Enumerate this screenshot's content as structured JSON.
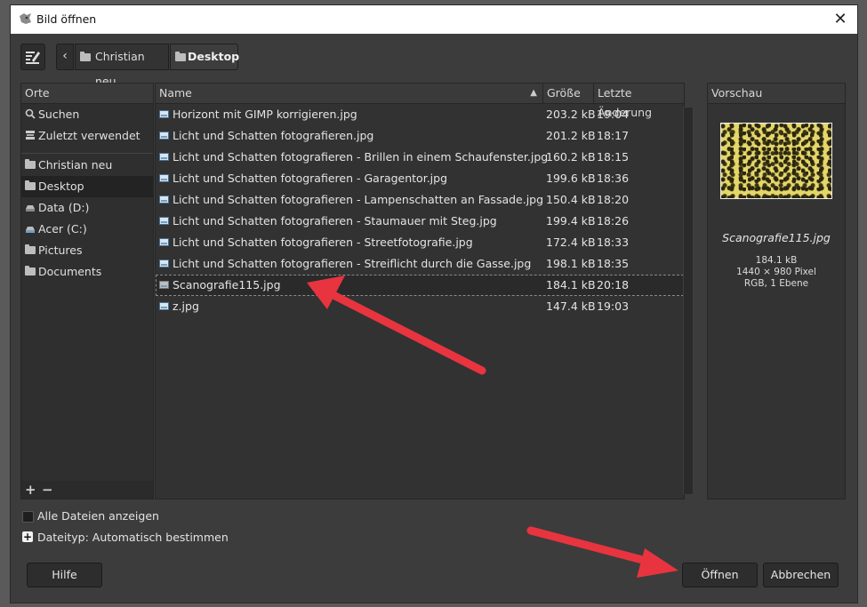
{
  "window": {
    "title": "Bild öffnen",
    "close_glyph": "✕"
  },
  "breadcrumb": {
    "back_glyph": "‹",
    "items": [
      {
        "label": "Christian neu"
      },
      {
        "label": "Desktop"
      }
    ]
  },
  "places": {
    "header": "Orte",
    "items": [
      {
        "label": "Suchen",
        "icon": "search-icon"
      },
      {
        "label": "Zuletzt verwendet",
        "icon": "recent-icon"
      },
      {
        "label": "Christian neu",
        "icon": "folder-icon"
      },
      {
        "label": "Desktop",
        "icon": "folder-icon",
        "selected": true
      },
      {
        "label": "Data (D:)",
        "icon": "drive-icon"
      },
      {
        "label": "Acer (C:)",
        "icon": "drive-icon"
      },
      {
        "label": "Pictures",
        "icon": "folder-icon"
      },
      {
        "label": "Documents",
        "icon": "folder-icon"
      }
    ],
    "add_glyph": "+",
    "remove_glyph": "−"
  },
  "files": {
    "columns": {
      "name": "Name",
      "size": "Größe",
      "modified": "Letzte Änderung"
    },
    "sort_glyph": "▲",
    "rows": [
      {
        "name": "Horizont mit GIMP korrigieren.jpg",
        "size": "203.2 kB",
        "date": "19:04"
      },
      {
        "name": "Licht und Schatten fotografieren.jpg",
        "size": "201.2 kB",
        "date": "18:17"
      },
      {
        "name": "Licht und Schatten fotografieren - Brillen in einem Schaufenster.jpg",
        "size": "160.2 kB",
        "date": "18:15"
      },
      {
        "name": "Licht und Schatten fotografieren - Garagentor.jpg",
        "size": "199.6 kB",
        "date": "18:36"
      },
      {
        "name": "Licht und Schatten fotografieren - Lampenschatten an Fassade.jpg",
        "size": "150.4 kB",
        "date": "18:20"
      },
      {
        "name": "Licht und Schatten fotografieren - Staumauer mit Steg.jpg",
        "size": "199.4 kB",
        "date": "18:26"
      },
      {
        "name": "Licht und Schatten fotografieren - Streetfotografie.jpg",
        "size": "172.4 kB",
        "date": "18:33"
      },
      {
        "name": "Licht und Schatten fotografieren - Streiflicht durch die Gasse.jpg",
        "size": "198.1 kB",
        "date": "18:35"
      },
      {
        "name": "Scanografie115.jpg",
        "size": "184.1 kB",
        "date": "20:18",
        "selected": true
      },
      {
        "name": "z.jpg",
        "size": "147.4 kB",
        "date": "19:03"
      }
    ]
  },
  "preview": {
    "header": "Vorschau",
    "filename": "Scanografie115.jpg",
    "filesize": "184.1 kB",
    "dimensions": "1440 × 980 Pixel",
    "mode": "RGB, 1 Ebene"
  },
  "options": {
    "show_all_label": "Alle Dateien anzeigen",
    "show_all_checked": false,
    "filetype_label": "Dateityp: Automatisch bestimmen",
    "expander_glyph": "+"
  },
  "buttons": {
    "help": "Hilfe",
    "open": "Öffnen",
    "cancel": "Abbrechen"
  },
  "colors": {
    "annotation_arrow": "#e8343f",
    "dialog_bg": "#3c3c3c"
  }
}
